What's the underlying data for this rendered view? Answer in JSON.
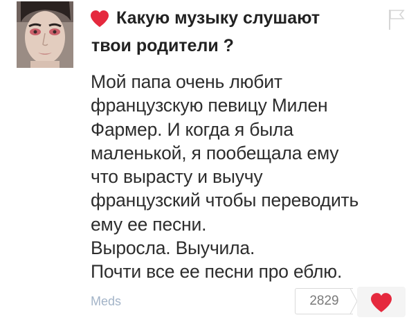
{
  "post": {
    "title_line1": "Какую музыку слушают",
    "title_line2": "твои родители ?",
    "body_lines": [
      "Мой папа очень любит",
      "французскую певицу Милен",
      "Фармер. И когда я была",
      "маленькой, я пообещала ему",
      "что вырасту и выучу",
      "французский чтобы переводить",
      "ему ее песни.",
      "Выросла. Выучила.",
      "Почти все ее песни про еблю."
    ],
    "author": "Meds",
    "like_count": "2829"
  },
  "icons": {
    "title_heart": "heart-icon",
    "report": "flag-icon",
    "like": "heart-icon"
  },
  "colors": {
    "accent_red": "#e5293e",
    "author_link": "#a3b4c8",
    "text": "#2d2d2d"
  }
}
